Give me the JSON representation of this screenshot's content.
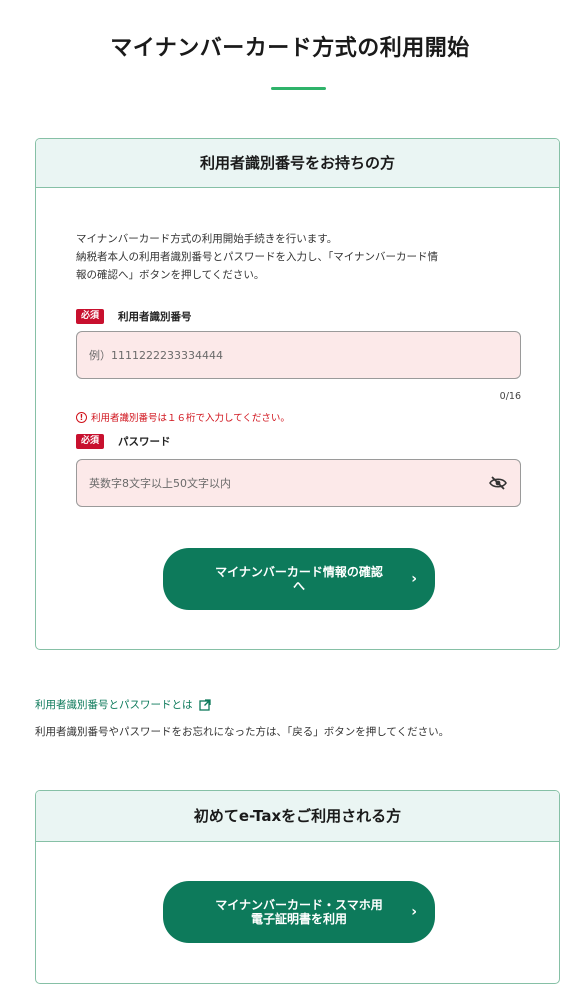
{
  "page_title": "マイナンバーカード方式の利用開始",
  "colors": {
    "accent": "#0d7a5b",
    "underline": "#2fb36a",
    "card_header_bg": "#eaf5f3",
    "error": "#d0121b",
    "required": "#c8102e",
    "input_bg": "#fce9e9"
  },
  "card1": {
    "header": "利用者識別番号をお持ちの方",
    "intro_lines": [
      "マイナンバーカード方式の利用開始手続きを行います。",
      "納税者本人の利用者識別番号とパスワードを入力し、「マイナンバーカード情",
      "報の確認へ」ボタンを押してください。"
    ],
    "required_badge": "必須",
    "id_field": {
      "label": "利用者識別番号",
      "placeholder": "例）1111222233334444",
      "counter": "0/16",
      "error": "利用者識別番号は１６桁で入力してください。"
    },
    "password_field": {
      "label": "パスワード",
      "placeholder": "英数字8文字以上50文字以内",
      "toggle_icon": "eye-slash-icon"
    },
    "confirm_button": {
      "line1": "マイナンバーカード情報の確認",
      "line2": "へ"
    }
  },
  "help": {
    "link_text": "利用者識別番号とパスワードとは",
    "link_icon": "external-link-icon",
    "note": "利用者識別番号やパスワードをお忘れになった方は、「戻る」ボタンを押してください。"
  },
  "card2": {
    "header": "初めてe-Taxをご利用される方",
    "button": {
      "line1": "マイナンバーカード・スマホ用",
      "line2": "電子証明書を利用"
    }
  }
}
